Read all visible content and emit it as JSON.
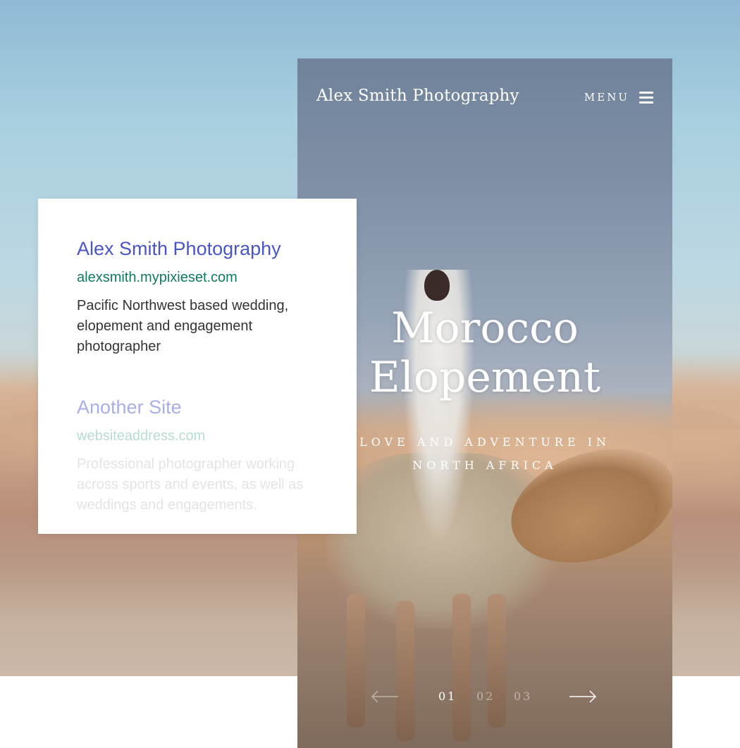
{
  "phone": {
    "brand": "Alex Smith Photography",
    "menu_label": "MENU",
    "hero_title_line1": "Morocco",
    "hero_title_line2": "Elopement",
    "hero_sub_line1": "LOVE AND ADVENTURE IN",
    "hero_sub_line2": "NORTH AFRICA",
    "pager": {
      "pages": [
        "01",
        "02",
        "03"
      ],
      "current": "01"
    }
  },
  "search_results": [
    {
      "title": "Alex Smith Photography",
      "url": "alexsmith.mypixieset.com",
      "description": "Pacific Northwest based wedding, elopement and engagement photographer"
    },
    {
      "title": "Another Site",
      "url": "websiteaddress.com",
      "description": "Professional photographer working across sports and events, as well as weddings and engagements."
    }
  ],
  "colors": {
    "result_title": "#4a55c8",
    "result_url": "#107a63",
    "result_desc": "#333333"
  },
  "icons": [
    "hamburger-menu-icon",
    "arrow-left-icon",
    "arrow-right-icon"
  ]
}
